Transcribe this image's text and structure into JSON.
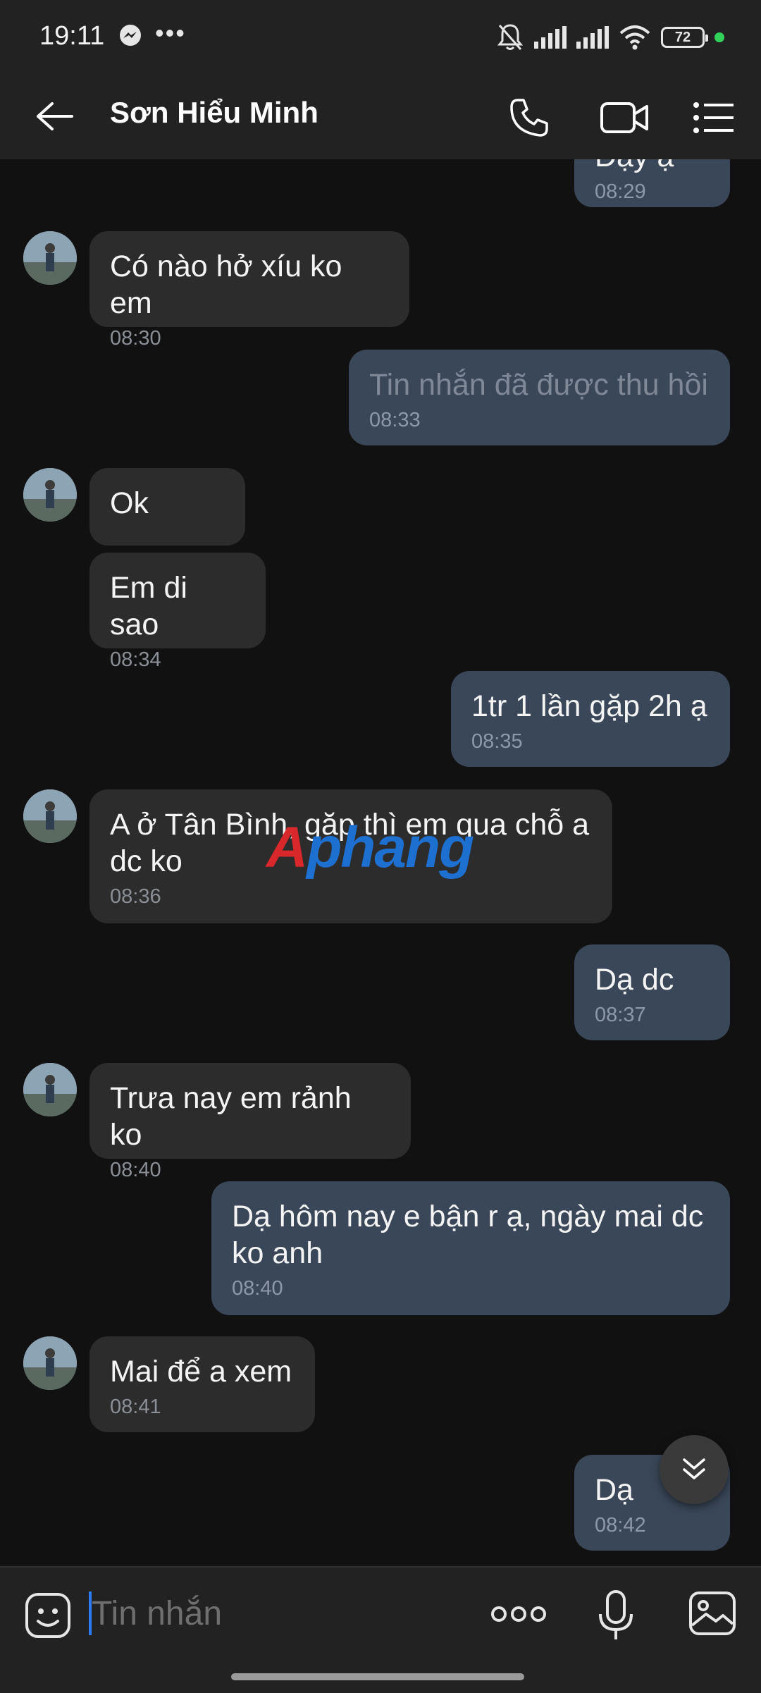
{
  "status_bar": {
    "time": "19:11",
    "battery": "72"
  },
  "header": {
    "title": "Sơn Hiểu Minh"
  },
  "messages": [
    {
      "dir": "out",
      "text": "Dạy ạ",
      "time": "08:29"
    },
    {
      "dir": "in",
      "text": "Có nào hở xíu ko em",
      "time": "08:30"
    },
    {
      "dir": "out",
      "text": "Tin nhắn đã được thu hồi",
      "time": "08:33",
      "recalled": true
    },
    {
      "dir": "in",
      "text": "Ok",
      "time": ""
    },
    {
      "dir": "in",
      "text": "Em di sao",
      "time": "08:34"
    },
    {
      "dir": "out",
      "text": "1tr 1 lần gặp 2h ạ",
      "time": "08:35"
    },
    {
      "dir": "in",
      "text": "A ở Tân Bình, gặp thì em qua chỗ a dc ko",
      "time": "08:36"
    },
    {
      "dir": "out",
      "text": "Dạ dc",
      "time": "08:37"
    },
    {
      "dir": "in",
      "text": "Trưa nay em rảnh ko",
      "time": "08:40"
    },
    {
      "dir": "out",
      "text": "Dạ hôm nay e bận r ạ, ngày mai dc ko anh",
      "time": "08:40"
    },
    {
      "dir": "in",
      "text": "Mai để a xem",
      "time": "08:41"
    },
    {
      "dir": "out",
      "text": "Dạ",
      "time": "08:42"
    }
  ],
  "watermark": {
    "part1": "A",
    "part2": "phang"
  },
  "composer": {
    "placeholder": "Tin nhắn"
  },
  "colors": {
    "incoming_bubble": "#2c2c2c",
    "outgoing_bubble": "#3a4759",
    "accent": "#2f7bf5"
  }
}
